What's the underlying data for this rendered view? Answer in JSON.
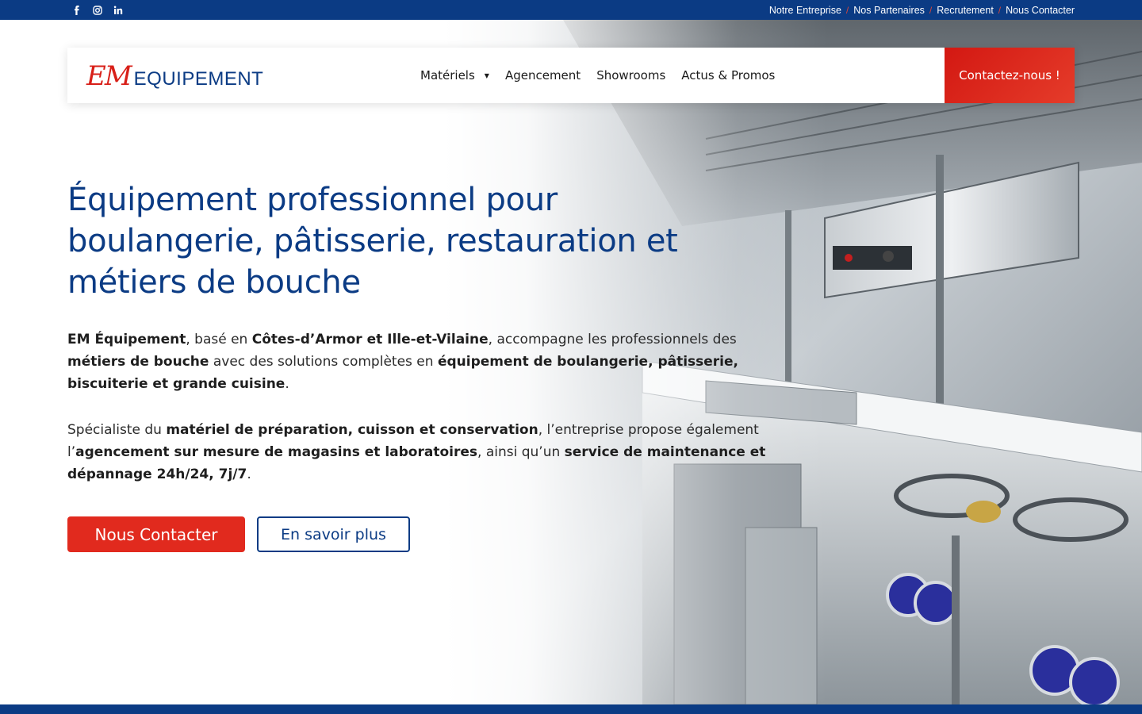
{
  "topbar": {
    "social": [
      {
        "icon": "facebook-icon"
      },
      {
        "icon": "instagram-icon"
      },
      {
        "icon": "linkedin-icon"
      }
    ],
    "links": [
      "Notre Entreprise",
      "Nos Partenaires",
      "Recrutement",
      "Nous Contacter"
    ],
    "separator": "/"
  },
  "header": {
    "logo_em": "EM",
    "logo_text": "EQUIPEMENT",
    "nav": [
      {
        "label": "Matériels",
        "has_dropdown": true
      },
      {
        "label": "Agencement"
      },
      {
        "label": "Showrooms"
      },
      {
        "label": "Actus & Promos"
      }
    ],
    "cta": "Contactez-nous !"
  },
  "hero": {
    "title": "Équipement professionnel pour boulangerie, pâtisserie, restauration et métiers de bouche",
    "p1": [
      {
        "t": "EM Équipement",
        "b": true
      },
      {
        "t": ", basé en ",
        "b": false
      },
      {
        "t": "Côtes-d’Armor et Ille-et-Vilaine",
        "b": true
      },
      {
        "t": ", accompagne les professionnels des ",
        "b": false
      },
      {
        "t": "métiers de bouche",
        "b": true
      },
      {
        "t": " avec des solutions complètes en ",
        "b": false
      },
      {
        "t": "équipement de boulangerie, pâtisserie, biscuiterie et grande cuisine",
        "b": true
      },
      {
        "t": ".",
        "b": false
      }
    ],
    "p2": [
      {
        "t": "Spécialiste du ",
        "b": false
      },
      {
        "t": "matériel de préparation, cuisson et conservation",
        "b": true
      },
      {
        "t": ", l’entreprise propose également l’",
        "b": false
      },
      {
        "t": "agencement sur mesure de magasins et laboratoires",
        "b": true
      },
      {
        "t": ", ainsi qu’un ",
        "b": false
      },
      {
        "t": "service de maintenance et dépannage 24h/24, 7j/7",
        "b": true
      },
      {
        "t": ".",
        "b": false
      }
    ],
    "btn_primary": "Nous Contacter",
    "btn_secondary": "En savoir plus"
  },
  "colors": {
    "brand_blue": "#0b3b84",
    "brand_red": "#e12a1e"
  }
}
